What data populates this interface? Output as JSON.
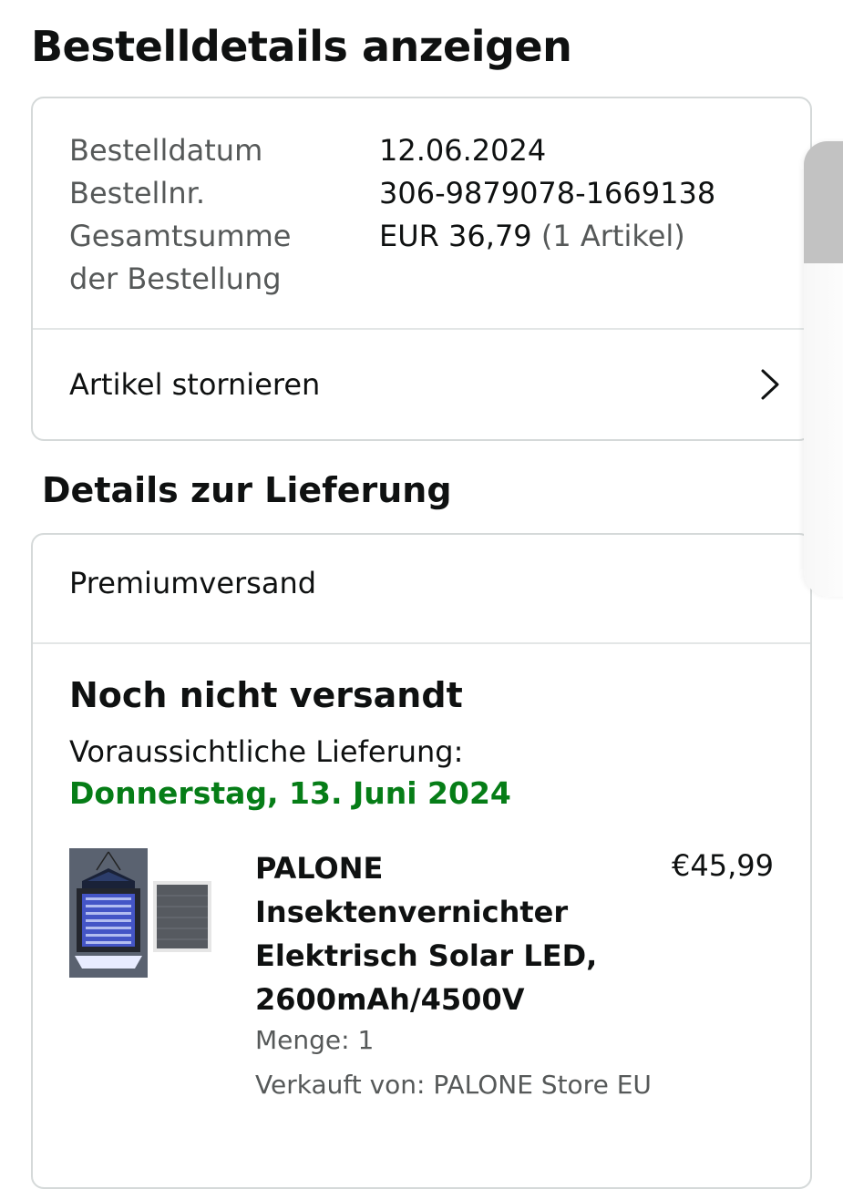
{
  "page_title": "Bestelldetails anzeigen",
  "order_summary": {
    "rows": [
      {
        "label": "Bestelldatum",
        "value": "12.06.2024"
      },
      {
        "label": "Bestellnr.",
        "value": "306-9879078-1669138"
      },
      {
        "label": "Gesamtsumme",
        "value": "EUR 36,79",
        "value_extra": "(1 Artikel)"
      },
      {
        "label": "der Bestellung",
        "value": ""
      }
    ],
    "cancel_label": "Artikel stornieren"
  },
  "delivery": {
    "section_title": "Details zur Lieferung",
    "shipping_method": "Premiumversand",
    "status": "Noch nicht versandt",
    "eta_label": "Voraussichtliche Lieferung:",
    "eta_date": "Donnerstag, 13. Juni 2024",
    "eta_color": "#067d17",
    "item": {
      "title": "PALONE Insektenvernichter Elektrisch Solar LED, 2600mAh/4500V",
      "price": "€45,99",
      "quantity": "Menge: 1",
      "seller": "Verkauft von: PALONE Store EU"
    }
  }
}
